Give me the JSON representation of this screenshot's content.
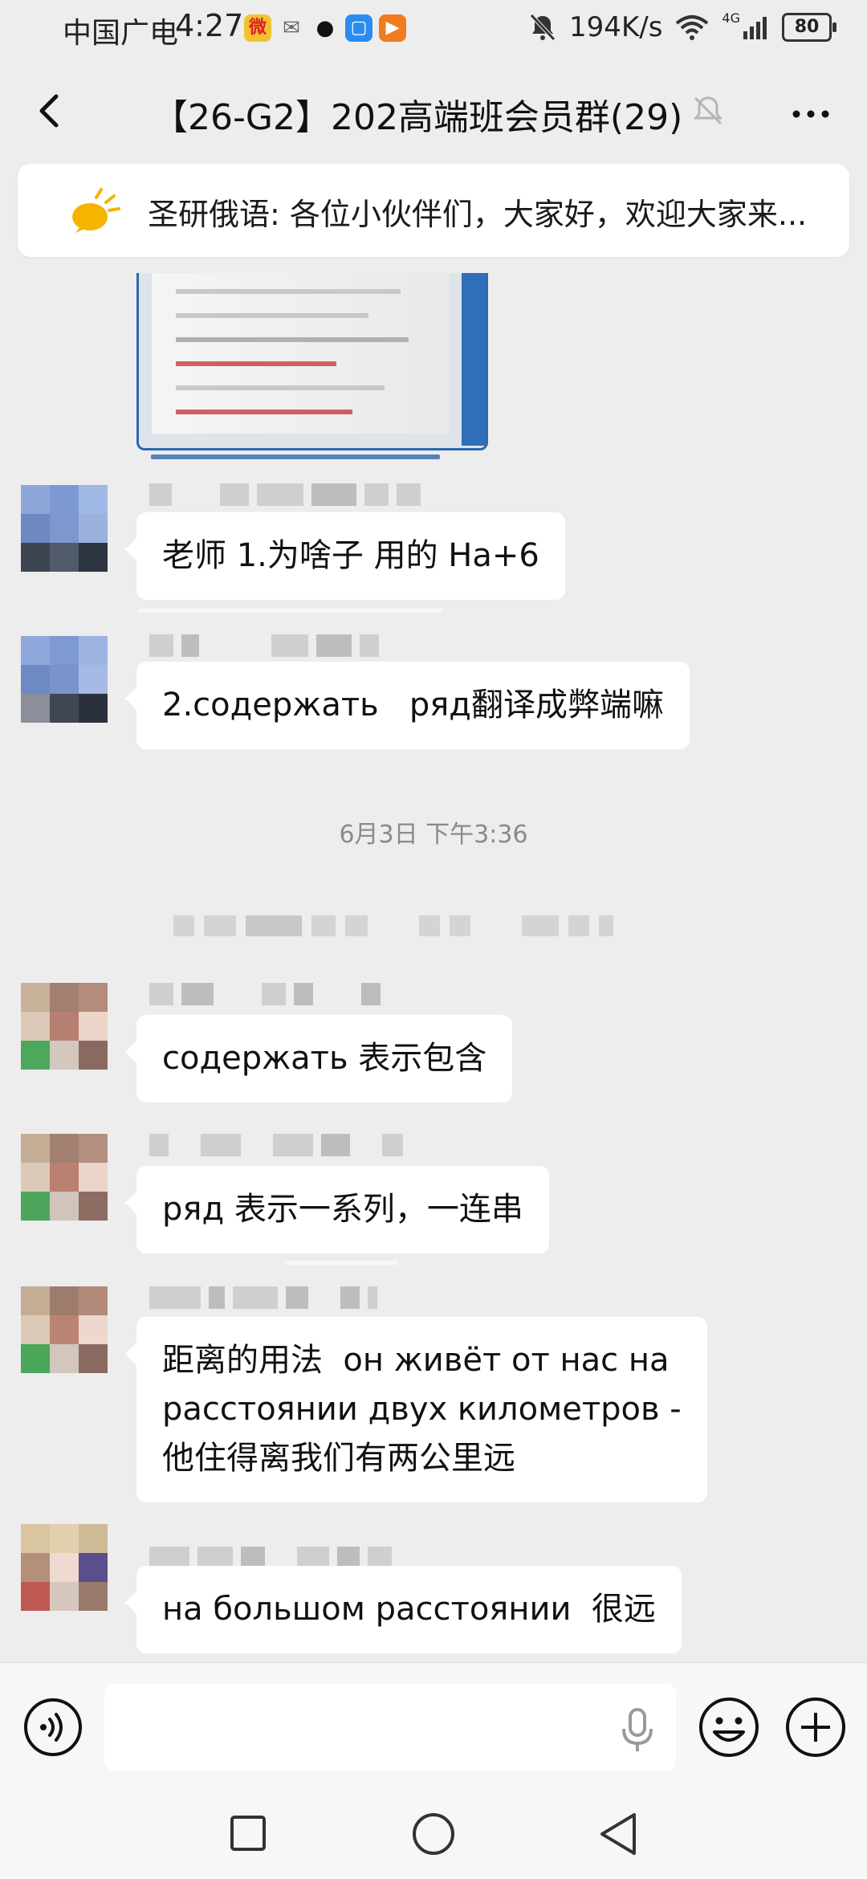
{
  "status_bar": {
    "carrier": "中国广电",
    "time": "4:27",
    "network_speed": "194K/s",
    "network_type": "4G",
    "battery": "80"
  },
  "header": {
    "title": "【26-G2】202高端班会员群(29)"
  },
  "notice": {
    "text": "圣研俄语: 各位小伙伴们，大家好，欢迎大家来..."
  },
  "messages": [
    {
      "text": "老师 1.为啥子 用的 Ha+6"
    },
    {
      "text": "2.содержать   ряд翻译成弊端嘛"
    },
    {
      "text": "содержать 表示包含"
    },
    {
      "text": "ряд 表示一系列，一连串"
    },
    {
      "text": "距离的用法  он живёт от нас на\nрасстоянии двух километров -\n他住得离我们有两公里远"
    },
    {
      "text": "на большом расстоянии  很远"
    }
  ],
  "timestamp": "6月3日 下午3:36",
  "colors": {
    "background": "#ededed",
    "bubble": "#ffffff",
    "accent_blue": "#2d67b0",
    "notice_icon": "#f5b400"
  }
}
